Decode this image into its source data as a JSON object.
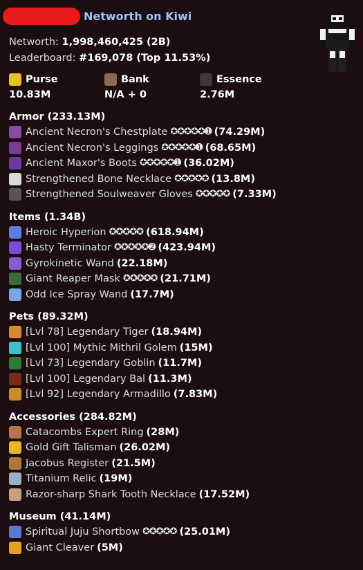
{
  "header": {
    "title": "Networth on Kiwi",
    "networth_label": "Networth:",
    "networth_value": "1,998,460,425 (2B)",
    "leaderboard_label": "Leaderboard:",
    "leaderboard_value": "#169,078 (Top 11.53%)"
  },
  "stats": {
    "purse_label": "Purse",
    "purse_value": "10.83M",
    "bank_label": "Bank",
    "bank_value": "N/A + 0",
    "essence_label": "Essence",
    "essence_value": "2.76M"
  },
  "armor": {
    "title": "Armor (233.13M)",
    "items": [
      {
        "name": "Ancient Necron's Chestplate",
        "stars": "✪✪✪✪✪➊",
        "value": "(74.29M)",
        "color": "#8c4aa8"
      },
      {
        "name": "Ancient Necron's Leggings",
        "stars": "✪✪✪✪✪➊",
        "value": "(68.65M)",
        "color": "#7a3c95"
      },
      {
        "name": "Ancient Maxor's Boots",
        "stars": "✪✪✪✪✪➊",
        "value": "(36.02M)",
        "color": "#6a3aa0"
      },
      {
        "name": "Strengthened Bone Necklace",
        "stars": "✪✪✪✪✪",
        "value": "(13.8M)",
        "color": "#d8d8d8"
      },
      {
        "name": "Strengthened Soulweaver Gloves",
        "stars": "✪✪✪✪✪",
        "value": "(7.33M)",
        "color": "#555555"
      }
    ]
  },
  "items": {
    "title": "Items (1.34B)",
    "items": [
      {
        "name": "Heroic Hyperion",
        "stars": "✪✪✪✪✪",
        "value": "(618.94M)",
        "color": "#5b7ee0"
      },
      {
        "name": "Hasty Terminator",
        "stars": "✪✪✪✪✪➋",
        "value": "(423.94M)",
        "color": "#7a4ad8"
      },
      {
        "name": "Gyrokinetic Wand",
        "stars": "",
        "value": "(22.18M)",
        "color": "#8a5ad0"
      },
      {
        "name": "Giant Reaper Mask",
        "stars": "✪✪✪✪✪",
        "value": "(21.71M)",
        "color": "#3c6b3c"
      },
      {
        "name": "Odd Ice Spray Wand",
        "stars": "",
        "value": "(17.7M)",
        "color": "#7aa6e8"
      }
    ]
  },
  "pets": {
    "title": "Pets (89.32M)",
    "items": [
      {
        "name": "[Lvl 78] Legendary Tiger",
        "value": "(18.94M)",
        "color": "#d88a2a"
      },
      {
        "name": "[Lvl 100] Mythic Mithril Golem",
        "value": "(15M)",
        "color": "#3cc4c4"
      },
      {
        "name": "[Lvl 73] Legendary Goblin",
        "value": "(11.7M)",
        "color": "#2f7a3a"
      },
      {
        "name": "[Lvl 100] Legendary Bal",
        "value": "(11.3M)",
        "color": "#7a2a1a"
      },
      {
        "name": "[Lvl 92] Legendary Armadillo",
        "value": "(7.83M)",
        "color": "#c88a2a"
      }
    ]
  },
  "accessories": {
    "title": "Accessories (284.82M)",
    "items": [
      {
        "name": "Catacombs Expert Ring",
        "value": "(28M)",
        "color": "#b8734a"
      },
      {
        "name": "Gold Gift Talisman",
        "value": "(26.02M)",
        "color": "#e8b820"
      },
      {
        "name": "Jacobus Register",
        "value": "(21.5M)",
        "color": "#b07838"
      },
      {
        "name": "Titanium Relic",
        "value": "(19M)",
        "color": "#9ab0c8"
      },
      {
        "name": "Razor-sharp Shark Tooth Necklace",
        "value": "(17.52M)",
        "color": "#c8a080"
      }
    ]
  },
  "museum": {
    "title": "Museum (41.14M)",
    "items": [
      {
        "name": "Spiritual Juju Shortbow",
        "stars": "✪✪✪✪✪",
        "value": "(25.01M)",
        "color": "#5a7ad0"
      },
      {
        "name": "Giant Cleaver",
        "value": "(5M)",
        "color": "#e8a020"
      }
    ]
  }
}
